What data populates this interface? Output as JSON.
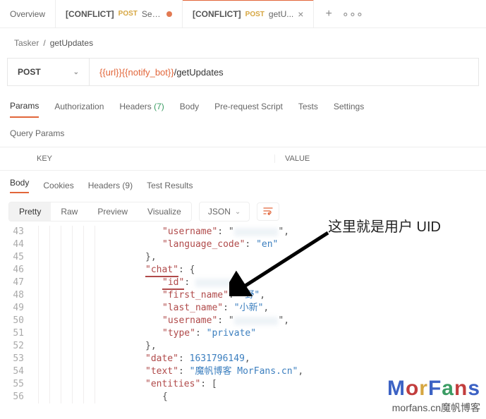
{
  "tabs": [
    {
      "label": "Overview"
    },
    {
      "conflict": "[CONFLICT]",
      "method": "POST",
      "title": "Sen...",
      "dirty": true
    },
    {
      "conflict": "[CONFLICT]",
      "method": "POST",
      "title": "getU..."
    }
  ],
  "breadcrumb": {
    "parent": "Tasker",
    "current": "getUpdates"
  },
  "request": {
    "method": "POST",
    "url_var1": "{{url}}",
    "url_var2": "{{notify_bot}}",
    "url_tail": "/getUpdates"
  },
  "reqtabs": {
    "params": "Params",
    "authorization": "Authorization",
    "headers": "Headers",
    "headers_count": "(7)",
    "body": "Body",
    "prerequest": "Pre-request Script",
    "tests": "Tests",
    "settings": "Settings"
  },
  "query_params_label": "Query Params",
  "columns": {
    "key": "KEY",
    "value": "VALUE"
  },
  "resptabs": {
    "body": "Body",
    "cookies": "Cookies",
    "headers": "Headers",
    "headers_count": "(9)",
    "testresults": "Test Results"
  },
  "viewbar": {
    "pretty": "Pretty",
    "raw": "Raw",
    "preview": "Preview",
    "visualize": "Visualize",
    "format": "JSON"
  },
  "code_lines": {
    "43": {
      "indent": 3,
      "key": "username",
      "blurred": true,
      "comma": true
    },
    "44": {
      "indent": 3,
      "key": "language_code",
      "str": "en",
      "close": false
    },
    "45": {
      "indent": 2,
      "raw": "},"
    },
    "46": {
      "indent": 2,
      "key": "chat",
      "open": "{",
      "underline_key": true
    },
    "47": {
      "indent": 3,
      "key": "id",
      "blurred_num": true,
      "underline_key": true,
      "comma": true
    },
    "48": {
      "indent": 3,
      "key": "first_name",
      "str": "野",
      "comma": true
    },
    "49": {
      "indent": 3,
      "key": "last_name",
      "str": "小新",
      "comma": true
    },
    "50": {
      "indent": 3,
      "key": "username",
      "blurred": true,
      "comma": true
    },
    "51": {
      "indent": 3,
      "key": "type",
      "str": "private"
    },
    "52": {
      "indent": 2,
      "raw": "},"
    },
    "53": {
      "indent": 2,
      "key": "date",
      "num": "1631796149",
      "comma": true
    },
    "54": {
      "indent": 2,
      "key": "text",
      "str": "魔帆博客 MorFans.cn",
      "comma": true
    },
    "55": {
      "indent": 2,
      "key": "entities",
      "open": "["
    },
    "56": {
      "indent": 3,
      "raw": "{"
    }
  },
  "annotation": "这里就是用户 UID",
  "watermark": {
    "logo": "MorFans",
    "sub": "morfans.cn魔帆博客"
  }
}
